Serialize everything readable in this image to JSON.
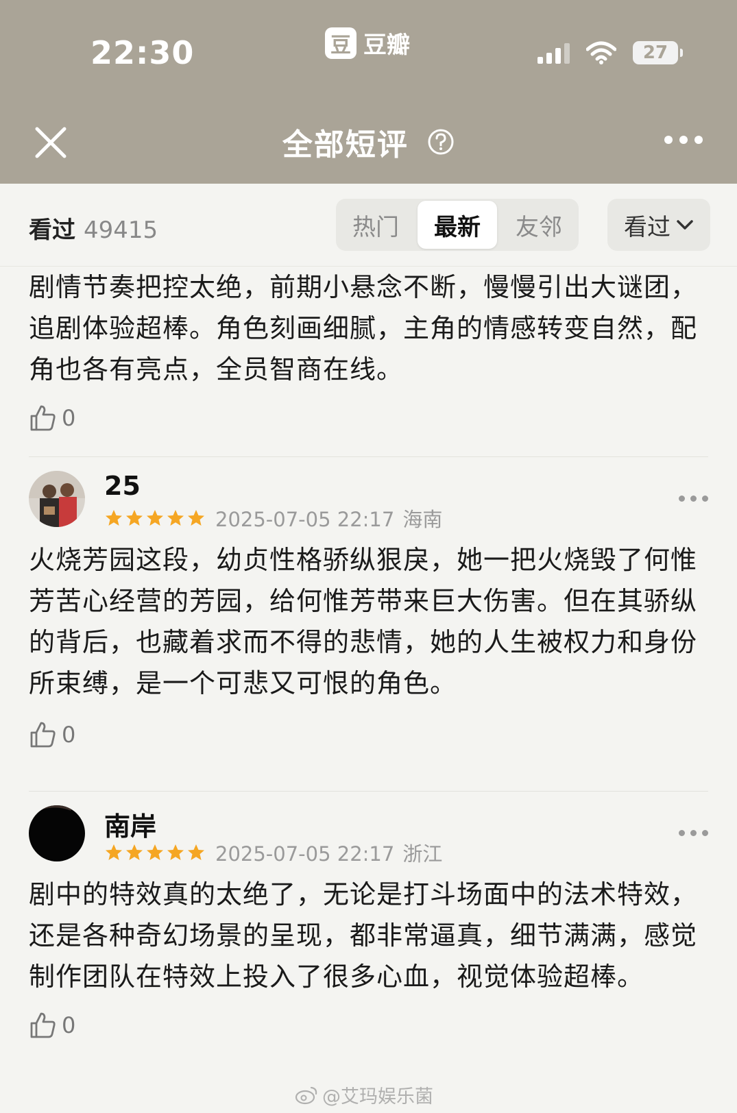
{
  "status_bar": {
    "time": "22:30",
    "app_logo": "豆",
    "app_name": "豆瓣",
    "battery": "27"
  },
  "header": {
    "title": "全部短评",
    "help_icon": "question-circle-icon",
    "close_icon": "close-icon",
    "more_icon": "more-horizontal-icon"
  },
  "filter": {
    "watched_label": "看过",
    "watched_count": "49415",
    "tabs": [
      {
        "label": "热门",
        "active": false
      },
      {
        "label": "最新",
        "active": true
      },
      {
        "label": "友邻",
        "active": false
      }
    ],
    "dropdown_label": "看过"
  },
  "comments": [
    {
      "partial": true,
      "body": "剧情节奏把控太绝，前期小悬念不断，慢慢引出大谜团，追剧体验超棒。角色刻画细腻，主角的情感转变自然，配角也各有亮点，全员智商在线。",
      "likes": "0"
    },
    {
      "user": "25",
      "rating": 5,
      "date": "2025-07-05 22:17",
      "region": "海南",
      "body": "火烧芳园这段，幼贞性格骄纵狠戾，她一把火烧毁了何惟芳苦心经营的芳园，给何惟芳带来巨大伤害。但在其骄纵的背后，也藏着求而不得的悲情，她的人生被权力和身份所束缚，是一个可悲又可恨的角色。",
      "likes": "0"
    },
    {
      "user": "南岸",
      "rating": 5,
      "date": "2025-07-05 22:17",
      "region": "浙江",
      "body": "剧中的特效真的太绝了，无论是打斗场面中的法术特效，还是各种奇幻场景的呈现，都非常逼真，细节满满，感觉制作团队在特效上投入了很多心血，视觉体验超棒。",
      "likes": "0"
    }
  ],
  "watermark": "@艾玛娱乐菌",
  "colors": {
    "header_bg": "#aaa497",
    "page_bg": "#f4f4f1",
    "star": "#f5a623",
    "meta": "#9a9a9a"
  }
}
